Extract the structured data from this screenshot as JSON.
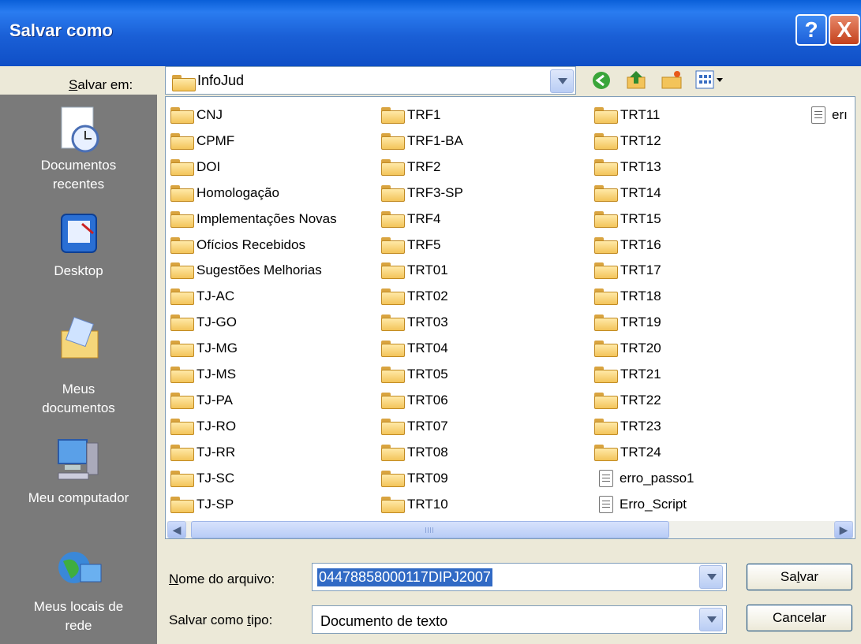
{
  "window": {
    "title": "Salvar como"
  },
  "titlebar": {
    "help_label": "?",
    "close_label": "X"
  },
  "lookin": {
    "label": "Salvar em:",
    "value": "InfoJud"
  },
  "places": [
    {
      "label": "Documentos\nrecentes",
      "icon": "recent-documents-icon"
    },
    {
      "label": "Desktop",
      "icon": "desktop-icon"
    },
    {
      "label": "Meus\ndocumentos",
      "icon": "my-documents-icon"
    },
    {
      "label": "Meu computador",
      "icon": "my-computer-icon"
    },
    {
      "label": "Meus locais de\nrede",
      "icon": "network-places-icon"
    }
  ],
  "files": {
    "col1": [
      "CNJ",
      "CPMF",
      "DOI",
      "Homologação",
      "Implementações Novas",
      "Ofícios Recebidos",
      "Sugestões Melhorias",
      "TJ-AC",
      "TJ-GO",
      "TJ-MG",
      "TJ-MS",
      "TJ-PA",
      "TJ-RO",
      "TJ-RR",
      "TJ-SC",
      "TJ-SP"
    ],
    "col2": [
      "TRF1",
      "TRF1-BA",
      "TRF2",
      "TRF3-SP",
      "TRF4",
      "TRF5",
      "TRT01",
      "TRT02",
      "TRT03",
      "TRT04",
      "TRT05",
      "TRT06",
      "TRT07",
      "TRT08",
      "TRT09",
      "TRT10"
    ],
    "col3": [
      "TRT11",
      "TRT12",
      "TRT13",
      "TRT14",
      "TRT15",
      "TRT16",
      "TRT17",
      "TRT18",
      "TRT19",
      "TRT20",
      "TRT21",
      "TRT22",
      "TRT23",
      "TRT24"
    ],
    "col3_docs": [
      "erro_passo1",
      "Erro_Script"
    ],
    "col4_docs": [
      "erı"
    ]
  },
  "filename": {
    "label": "Nome do arquivo:",
    "value": "04478858000117DIPJ2007"
  },
  "filetype": {
    "label": "Salvar como tipo:",
    "value": "Documento de texto"
  },
  "buttons": {
    "save": "Salvar",
    "cancel": "Cancelar"
  }
}
